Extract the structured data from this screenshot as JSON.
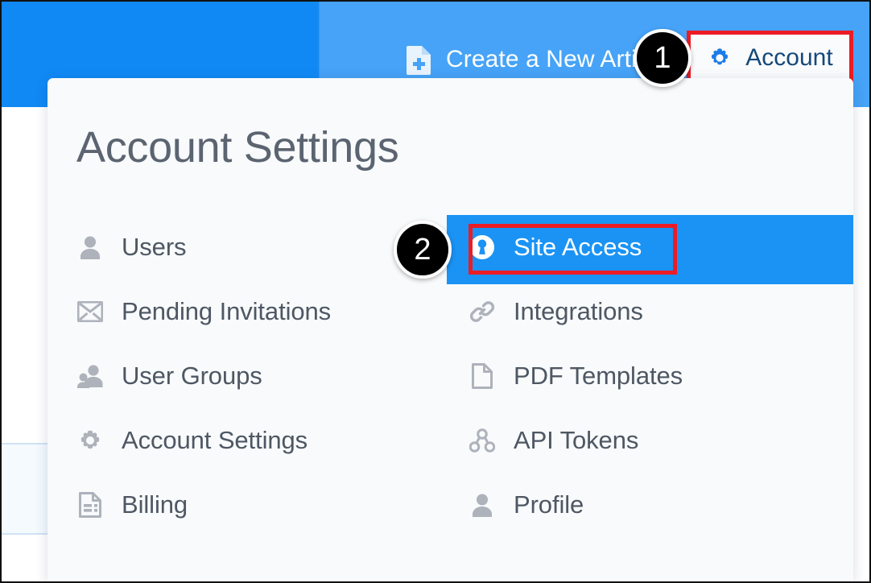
{
  "header": {
    "create_article": {
      "label": "Create a New Article",
      "icon": "file-plus-icon"
    },
    "account_button": {
      "label": "Account",
      "icon": "gear-icon"
    },
    "left_bar_color": "#1089f5",
    "right_bar_color": "#46a3f7"
  },
  "dropdown": {
    "title": "Account Settings",
    "background": "#f8fafb",
    "left_column": [
      {
        "label": "Users",
        "icon": "user-icon"
      },
      {
        "label": "Pending Invitations",
        "icon": "envelope-icon"
      },
      {
        "label": "User Groups",
        "icon": "users-icon"
      },
      {
        "label": "Account Settings",
        "icon": "gear-icon"
      },
      {
        "label": "Billing",
        "icon": "invoice-icon"
      }
    ],
    "right_column": [
      {
        "label": "Site Access",
        "icon": "lock-keyhole-icon",
        "selected": true
      },
      {
        "label": "Integrations",
        "icon": "link-icon",
        "selected": false
      },
      {
        "label": "PDF Templates",
        "icon": "document-icon",
        "selected": false
      },
      {
        "label": "API Tokens",
        "icon": "sitemap-icon",
        "selected": false
      },
      {
        "label": "Profile",
        "icon": "user-icon",
        "selected": false
      }
    ],
    "highlight_color": "#1a93f5"
  },
  "annotations": {
    "callout_color": "#ec1c24",
    "steps": [
      {
        "number": "1",
        "target": "account-button"
      },
      {
        "number": "2",
        "target": "site-access-item"
      }
    ]
  }
}
